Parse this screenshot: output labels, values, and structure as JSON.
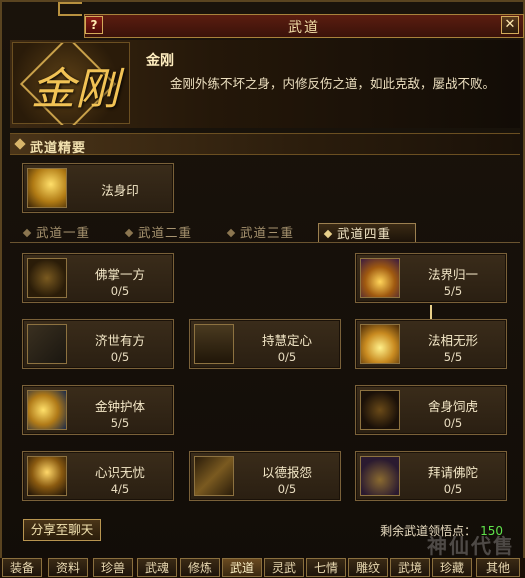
{
  "window": {
    "title": "武道",
    "help_label": "?",
    "close_label": "✕"
  },
  "header": {
    "emblem_text": "金刚",
    "skill_name": "金刚",
    "description": "金刚外练不坏之身，内修反伤之道，如此克敌，屡战不败。"
  },
  "essence": {
    "section_title": "武道精要",
    "skill": {
      "name": "法身印",
      "icon": "golden-sword-icon"
    }
  },
  "tabs": [
    {
      "label": "武道一重",
      "active": false
    },
    {
      "label": "武道二重",
      "active": false
    },
    {
      "label": "武道三重",
      "active": false
    },
    {
      "label": "武道四重",
      "active": true
    }
  ],
  "skills": [
    {
      "name": "佛掌一方",
      "level": "0/5",
      "icon": "rune-circle-icon"
    },
    {
      "name": "法界归一",
      "level": "5/5",
      "icon": "purple-rune-icon"
    },
    {
      "name": "济世有方",
      "level": "0/5",
      "icon": "swastika-icon"
    },
    {
      "name": "持慧定心",
      "level": "0/5",
      "icon": "figure-icon"
    },
    {
      "name": "法相无形",
      "level": "5/5",
      "icon": "glow-hand-icon"
    },
    {
      "name": "金钟护体",
      "level": "5/5",
      "icon": "shield-icon"
    },
    {
      "name": "舍身饲虎",
      "level": "0/5",
      "icon": "tiger-icon"
    },
    {
      "name": "心识无忧",
      "level": "4/5",
      "icon": "monk-icon"
    },
    {
      "name": "以德报怨",
      "level": "0/5",
      "icon": "sword-slash-icon"
    },
    {
      "name": "拜请佛陀",
      "level": "0/5",
      "icon": "buddha-icon"
    }
  ],
  "footer": {
    "share_label": "分享至聊天",
    "points_label": "剩余武道领悟点：",
    "points_value": "150",
    "watermark": "神仙代售"
  },
  "bottom_tabs": [
    "装备",
    "资料",
    "珍兽",
    "武魂",
    "修炼",
    "武道",
    "灵武",
    "七情",
    "雕纹",
    "武境",
    "珍藏",
    "其他"
  ],
  "bottom_active": "武道",
  "colors": {
    "accent_gold": "#d8b56a",
    "points_green": "#5fe24a",
    "title_red": "#5b1d10"
  }
}
